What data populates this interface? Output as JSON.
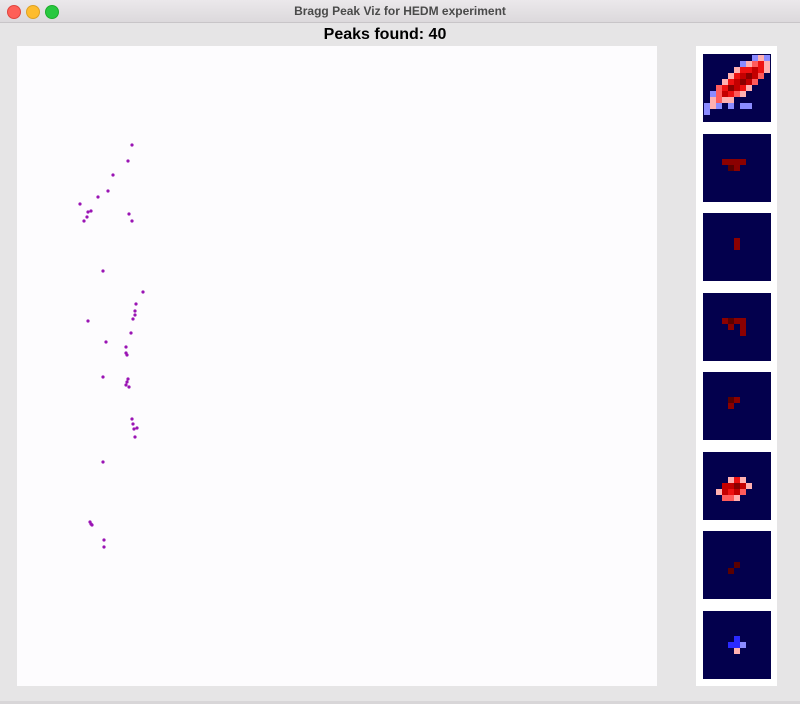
{
  "window": {
    "title": "Bragg Peak Viz for HEDM experiment"
  },
  "heading": {
    "text": "Peaks found: 40"
  },
  "colors": {
    "peak_marker": "#9a14b4",
    "thumb_background": "#03004d",
    "heat_scale": [
      "#5a0000",
      "#8b0000",
      "#c40000",
      "#ee1111",
      "#ff5b5b",
      "#ffb0b0",
      "#8b8bff",
      "#2a2aff"
    ]
  },
  "chart_data": {
    "type": "scatter",
    "title": "",
    "xlabel": "",
    "ylabel": "",
    "xlim": [
      0,
      640
    ],
    "ylim": [
      0,
      640
    ],
    "points": [
      [
        115,
        99
      ],
      [
        111,
        115
      ],
      [
        96,
        129
      ],
      [
        91,
        145
      ],
      [
        81,
        151
      ],
      [
        63,
        158
      ],
      [
        74,
        165
      ],
      [
        71,
        166
      ],
      [
        70,
        171
      ],
      [
        67,
        175
      ],
      [
        115,
        175
      ],
      [
        86,
        225
      ],
      [
        126,
        246
      ],
      [
        119,
        258
      ],
      [
        118,
        269
      ],
      [
        116,
        273
      ],
      [
        71,
        275
      ],
      [
        114,
        287
      ],
      [
        89,
        296
      ],
      [
        109,
        301
      ],
      [
        109,
        307
      ],
      [
        110,
        309
      ],
      [
        86,
        331
      ],
      [
        111,
        333
      ],
      [
        110,
        336
      ],
      [
        109,
        339
      ],
      [
        115,
        373
      ],
      [
        120,
        382
      ],
      [
        118,
        391
      ],
      [
        86,
        416
      ],
      [
        73,
        476
      ],
      [
        75,
        479
      ],
      [
        87,
        494
      ],
      [
        87,
        501
      ],
      [
        112,
        168
      ],
      [
        118,
        265
      ],
      [
        112,
        341
      ],
      [
        116,
        378
      ],
      [
        117,
        383
      ],
      [
        74,
        478
      ]
    ]
  },
  "thumbnails": [
    {
      "name": "peak-thumbnail-1",
      "pixels": [
        [
          8,
          0,
          6
        ],
        [
          9,
          0,
          5
        ],
        [
          10,
          0,
          6
        ],
        [
          6,
          1,
          6
        ],
        [
          7,
          1,
          5
        ],
        [
          8,
          1,
          4
        ],
        [
          9,
          1,
          3
        ],
        [
          10,
          1,
          5
        ],
        [
          5,
          2,
          5
        ],
        [
          6,
          2,
          3
        ],
        [
          7,
          2,
          3
        ],
        [
          8,
          2,
          2
        ],
        [
          9,
          2,
          3
        ],
        [
          10,
          2,
          5
        ],
        [
          4,
          3,
          5
        ],
        [
          5,
          3,
          3
        ],
        [
          6,
          3,
          2
        ],
        [
          7,
          3,
          1
        ],
        [
          8,
          3,
          2
        ],
        [
          9,
          3,
          4
        ],
        [
          3,
          4,
          5
        ],
        [
          4,
          4,
          3
        ],
        [
          5,
          4,
          2
        ],
        [
          6,
          4,
          1
        ],
        [
          7,
          4,
          2
        ],
        [
          8,
          4,
          4
        ],
        [
          2,
          5,
          4
        ],
        [
          3,
          5,
          3
        ],
        [
          4,
          5,
          1
        ],
        [
          5,
          5,
          2
        ],
        [
          6,
          5,
          3
        ],
        [
          7,
          5,
          5
        ],
        [
          1,
          6,
          6
        ],
        [
          2,
          6,
          4
        ],
        [
          3,
          6,
          2
        ],
        [
          4,
          6,
          3
        ],
        [
          5,
          6,
          4
        ],
        [
          6,
          6,
          5
        ],
        [
          1,
          7,
          5
        ],
        [
          2,
          7,
          4
        ],
        [
          3,
          7,
          5
        ],
        [
          4,
          7,
          5
        ],
        [
          0,
          8,
          6
        ],
        [
          1,
          8,
          5
        ],
        [
          2,
          8,
          6
        ],
        [
          4,
          8,
          6
        ],
        [
          6,
          8,
          6
        ],
        [
          7,
          8,
          6
        ],
        [
          0,
          9,
          6
        ]
      ]
    },
    {
      "name": "peak-thumbnail-2",
      "pixels": [
        [
          3,
          4,
          1
        ],
        [
          4,
          4,
          1
        ],
        [
          5,
          4,
          1
        ],
        [
          6,
          4,
          1
        ],
        [
          4,
          5,
          0
        ],
        [
          5,
          5,
          1
        ]
      ]
    },
    {
      "name": "peak-thumbnail-3",
      "pixels": [
        [
          5,
          4,
          1
        ],
        [
          5,
          5,
          1
        ]
      ]
    },
    {
      "name": "peak-thumbnail-4",
      "pixels": [
        [
          3,
          4,
          1
        ],
        [
          4,
          4,
          0
        ],
        [
          5,
          4,
          1
        ],
        [
          6,
          4,
          1
        ],
        [
          4,
          5,
          1
        ],
        [
          6,
          5,
          1
        ],
        [
          6,
          6,
          1
        ]
      ]
    },
    {
      "name": "peak-thumbnail-5",
      "pixels": [
        [
          4,
          4,
          0
        ],
        [
          5,
          4,
          1
        ],
        [
          4,
          5,
          1
        ]
      ]
    },
    {
      "name": "peak-thumbnail-6",
      "pixels": [
        [
          4,
          4,
          5
        ],
        [
          5,
          4,
          3
        ],
        [
          6,
          4,
          5
        ],
        [
          3,
          5,
          2
        ],
        [
          4,
          5,
          2
        ],
        [
          5,
          5,
          1
        ],
        [
          6,
          5,
          2
        ],
        [
          7,
          5,
          5
        ],
        [
          2,
          6,
          5
        ],
        [
          3,
          6,
          2
        ],
        [
          4,
          6,
          3
        ],
        [
          5,
          6,
          2
        ],
        [
          6,
          6,
          4
        ],
        [
          3,
          7,
          4
        ],
        [
          4,
          7,
          4
        ],
        [
          5,
          7,
          5
        ]
      ]
    },
    {
      "name": "peak-thumbnail-7",
      "pixels": [
        [
          5,
          5,
          0
        ],
        [
          4,
          6,
          0
        ]
      ]
    },
    {
      "name": "peak-thumbnail-8",
      "pixels": [
        [
          5,
          4,
          7
        ],
        [
          4,
          5,
          7
        ],
        [
          5,
          5,
          7
        ],
        [
          6,
          5,
          6
        ],
        [
          5,
          6,
          5
        ]
      ]
    }
  ]
}
